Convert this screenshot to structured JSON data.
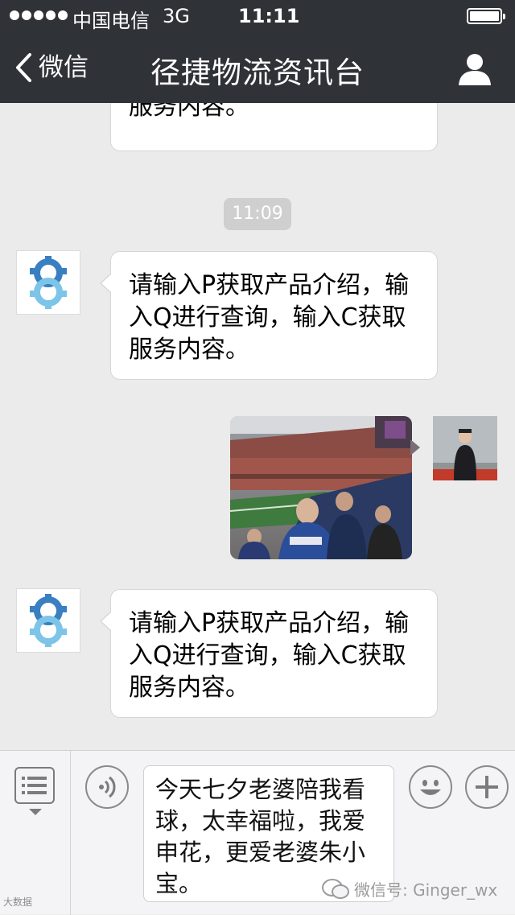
{
  "status_bar": {
    "carrier": "中国电信",
    "network": "3G",
    "time": "11:11"
  },
  "nav": {
    "back_label": "微信",
    "title": "径捷物流资讯台"
  },
  "messages": [
    {
      "text": "服务内容。"
    },
    {
      "timestamp": "11:09"
    },
    {
      "text_lines": [
        "请输入P获取产品介绍，输",
        "入Q进行查询，输入C获取",
        "服务内容。"
      ]
    },
    {
      "photo": "stadium-photo"
    },
    {
      "text_lines": [
        "请输入P获取产品介绍，输",
        "入Q进行查询，输入C获取",
        "服务内容。"
      ]
    }
  ],
  "input": {
    "lines": [
      "今天七夕老婆陪我看",
      "球，太幸福啦，我爱",
      "申花，更爱老婆朱小",
      "宝。"
    ]
  },
  "watermark": {
    "wechat_id": "微信号: Ginger_wx",
    "left_text": "大数据"
  },
  "icons": [
    "back-chevron-icon",
    "profile-icon",
    "gear-logo-icon",
    "menu-list-icon",
    "voice-icon",
    "emoji-icon",
    "plus-icon",
    "wechat-logo-icon"
  ],
  "colors": {
    "nav_bg": "#2f3237",
    "chat_bg": "#ebebeb",
    "bubble_bg": "#ffffff",
    "logo_blue": "#3a7fc1",
    "logo_light": "#7cc5e8"
  }
}
